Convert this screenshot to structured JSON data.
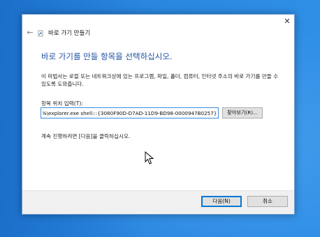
{
  "wizard": {
    "back_icon": "back-arrow-icon",
    "window_title": "바로 가기 만들기",
    "close_glyph": "✕",
    "heading": "바로 가기를 만들 항목을 선택하십시오.",
    "description": "이 마법사는 로컬 또는 네트워크상에 있는 프로그램, 파일, 폴더, 컴퓨터, 인터넷 주소의 바로 가기를 만들 수 있도록 도와줍니다.",
    "location_label": "항목 위치 입력(T):",
    "location_value": "%windir%\\explorer.exe shell:::{3080F90D-D7AD-11D9-BD98-0000947B0257}",
    "browse_label": "찾아보기(R)...",
    "hint": "계속 진행하려면 [다음]을 클릭하십시오.",
    "next_label": "다음(N)",
    "cancel_label": "취소"
  },
  "colors": {
    "heading": "#1c4fa0",
    "accent": "#0078d7",
    "desktop": "#2a86df"
  }
}
